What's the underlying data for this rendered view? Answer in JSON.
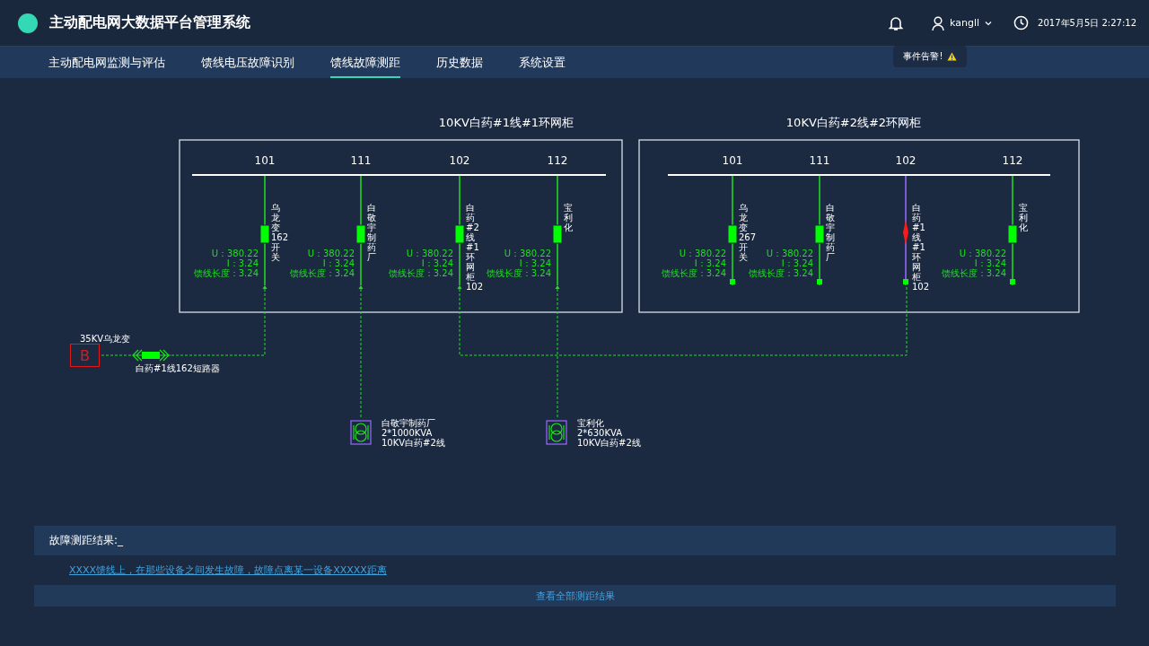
{
  "header": {
    "title": "主动配电网大数据平台管理系统",
    "user": "kangll",
    "datetime": "2017年5月5日  2:27:12",
    "alert": "事件告警!"
  },
  "nav": [
    {
      "label": "主动配电网监测与评估",
      "selected": false
    },
    {
      "label": "馈线电压故障识别",
      "selected": false
    },
    {
      "label": "馈线故障测距",
      "selected": true
    },
    {
      "label": "历史数据",
      "selected": false
    },
    {
      "label": "系统设置",
      "selected": false
    }
  ],
  "cabinets": [
    {
      "title": "10KV白药#1线#1环网柜",
      "kind": "arrow",
      "feeders": [
        {
          "number": "101",
          "name": "乌龙变162开关",
          "fault": false,
          "readings": [
            "U：380.22",
            "I：3.24",
            "馈线长度：3.24"
          ]
        },
        {
          "number": "111",
          "name": "白敬宇制药厂",
          "fault": false,
          "readings": [
            "U：380.22",
            "I：3.24",
            "馈线长度：3.24"
          ]
        },
        {
          "number": "102",
          "name": "白药#2线#1环网柜102",
          "fault": false,
          "readings": [
            "U：380.22",
            "I：3.24",
            "馈线长度：3.24"
          ]
        },
        {
          "number": "112",
          "name": "宝利化",
          "fault": false,
          "readings": [
            "U：380.22",
            "I：3.24",
            "馈线长度：3.24"
          ]
        }
      ]
    },
    {
      "title": "10KV白药#2线#2环网柜",
      "kind": "square",
      "feeders": [
        {
          "number": "101",
          "name": "乌龙变267开关",
          "fault": false,
          "readings": [
            "U：380.22",
            "I：3.24",
            "馈线长度：3.24"
          ]
        },
        {
          "number": "111",
          "name": "白敬宇制药厂",
          "fault": false,
          "readings": [
            "U：380.22",
            "I：3.24",
            "馈线长度：3.24"
          ]
        },
        {
          "number": "102",
          "name": "白药#1线#1环网柜102",
          "fault": true
        },
        {
          "number": "112",
          "name": "宝利化",
          "fault": false,
          "readings": [
            "U：380.22",
            "I：3.24",
            "馈线长度：3.24"
          ]
        }
      ]
    }
  ],
  "source": {
    "label": "35KV乌龙变",
    "symbol": "B"
  },
  "breaker": {
    "label": "白药#1线162短路器"
  },
  "transformers": [
    {
      "lines": [
        "白敬宇制药厂",
        "2*1000KVA",
        "10KV白药#2线"
      ]
    },
    {
      "lines": [
        "宝利化",
        "2*630KVA",
        "10KV白药#2线"
      ]
    }
  ],
  "result": {
    "heading": "故障测距结果:_",
    "message": "XXXX馈线上，在那些设备之间发生故障，故障点离某一设备XXXXX距离",
    "more": "查看全部测距结果"
  }
}
